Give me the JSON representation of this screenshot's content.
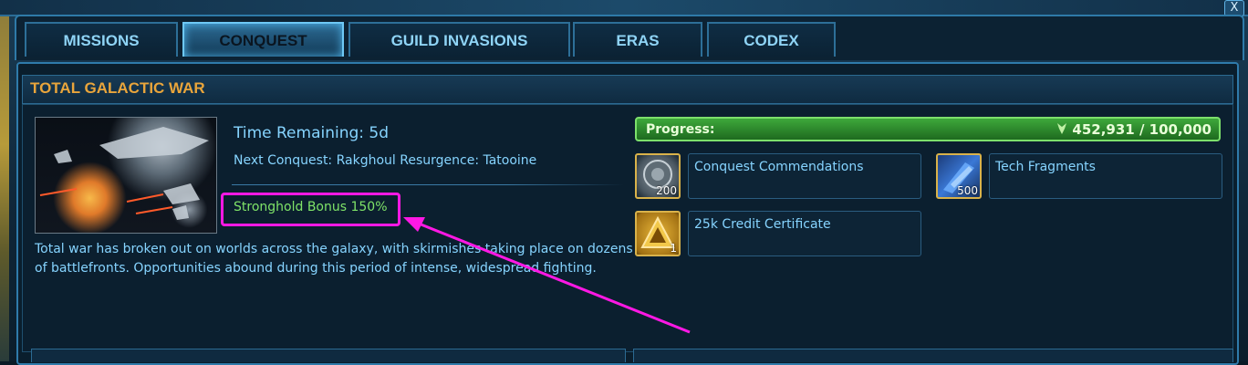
{
  "window": {
    "close_label": "X"
  },
  "tabs": [
    {
      "label": "MISSIONS",
      "active": false
    },
    {
      "label": "CONQUEST",
      "active": true
    },
    {
      "label": "GUILD INVASIONS",
      "active": false
    },
    {
      "label": "ERAS",
      "active": false
    },
    {
      "label": "CODEX",
      "active": false
    }
  ],
  "conquest": {
    "title": "TOTAL GALACTIC WAR",
    "time_remaining": "Time Remaining: 5d",
    "next_conquest": "Next Conquest: Rakghoul Resurgence: Tatooine",
    "stronghold_bonus": "Stronghold Bonus 150%",
    "description": "Total war has broken out on worlds across the galaxy, with skirmishes taking place on dozens of battlefronts. Opportunities abound during this period of intense, widespread fighting."
  },
  "progress": {
    "label": "Progress:",
    "value": "452,931 / 100,000",
    "fraction": 1.0,
    "color": "#3ea83b"
  },
  "rewards": [
    {
      "name": "Conquest Commendations",
      "count": "200",
      "icon": "commendation-medal-icon"
    },
    {
      "name": "Tech Fragments",
      "count": "500",
      "icon": "tech-fragment-icon"
    },
    {
      "name": "25k Credit Certificate",
      "count": "1",
      "icon": "credit-certificate-icon"
    }
  ],
  "annotation": {
    "color": "#ff18e4"
  },
  "colors": {
    "accent_blue": "#86d4ff",
    "title_orange": "#e9a53b",
    "bonus_green": "#7fe368"
  }
}
